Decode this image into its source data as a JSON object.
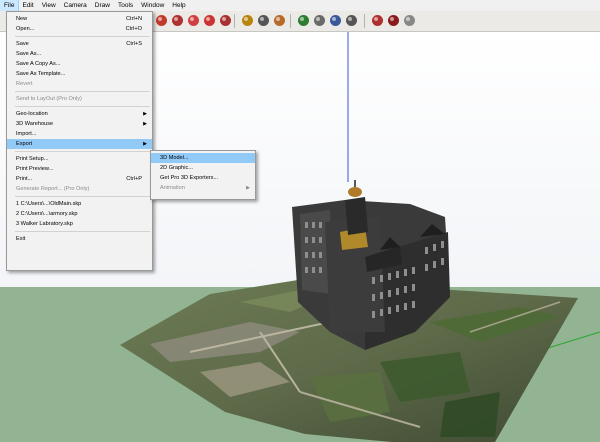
{
  "menubar": [
    "File",
    "Edit",
    "View",
    "Camera",
    "Draw",
    "Tools",
    "Window",
    "Help"
  ],
  "file_menu": [
    {
      "label": "New",
      "shortcut": "Ctrl+N"
    },
    {
      "label": "Open...",
      "shortcut": "Ctrl+O"
    },
    {
      "sep": true
    },
    {
      "label": "Save",
      "shortcut": "Ctrl+S"
    },
    {
      "label": "Save As..."
    },
    {
      "label": "Save A Copy As..."
    },
    {
      "label": "Save As Template..."
    },
    {
      "label": "Revert",
      "disabled": true
    },
    {
      "sep": true
    },
    {
      "label": "Send to LayOut (Pro Only)",
      "disabled": true
    },
    {
      "sep": true
    },
    {
      "label": "Geo-location",
      "submenu": true
    },
    {
      "label": "3D Warehouse",
      "submenu": true
    },
    {
      "label": "Import..."
    },
    {
      "label": "Export",
      "submenu": true,
      "highlighted": true
    },
    {
      "sep": true
    },
    {
      "label": "Print Setup..."
    },
    {
      "label": "Print Preview..."
    },
    {
      "label": "Print...",
      "shortcut": "Ctrl+P"
    },
    {
      "label": "Generate Report... (Pro Only)",
      "disabled": true
    },
    {
      "sep": true
    },
    {
      "label": "1 C:\\Users\\...\\OldMain.skp"
    },
    {
      "label": "2 C:\\Users\\...\\armory.skp"
    },
    {
      "label": "3 Walker Labratory.skp"
    },
    {
      "sep": true
    },
    {
      "label": "Exit"
    }
  ],
  "export_menu": [
    {
      "label": "3D Model...",
      "highlighted": true
    },
    {
      "label": "2D Graphic..."
    },
    {
      "label": "Get Pro 3D Exporters..."
    },
    {
      "label": "Animation",
      "submenu": true,
      "disabled": true
    }
  ],
  "toolbar_icons": [
    "orbit-icon",
    "paint-icon",
    "rotate-icon",
    "move-icon",
    "scale-icon",
    "tape-measure-icon",
    "text-icon",
    "paint-bucket-icon",
    "orbit-tool-icon",
    "pan-icon",
    "zoom-icon",
    "zoom-extents-icon",
    "warehouse-icon",
    "extension-warehouse-icon",
    "layout-icon"
  ]
}
